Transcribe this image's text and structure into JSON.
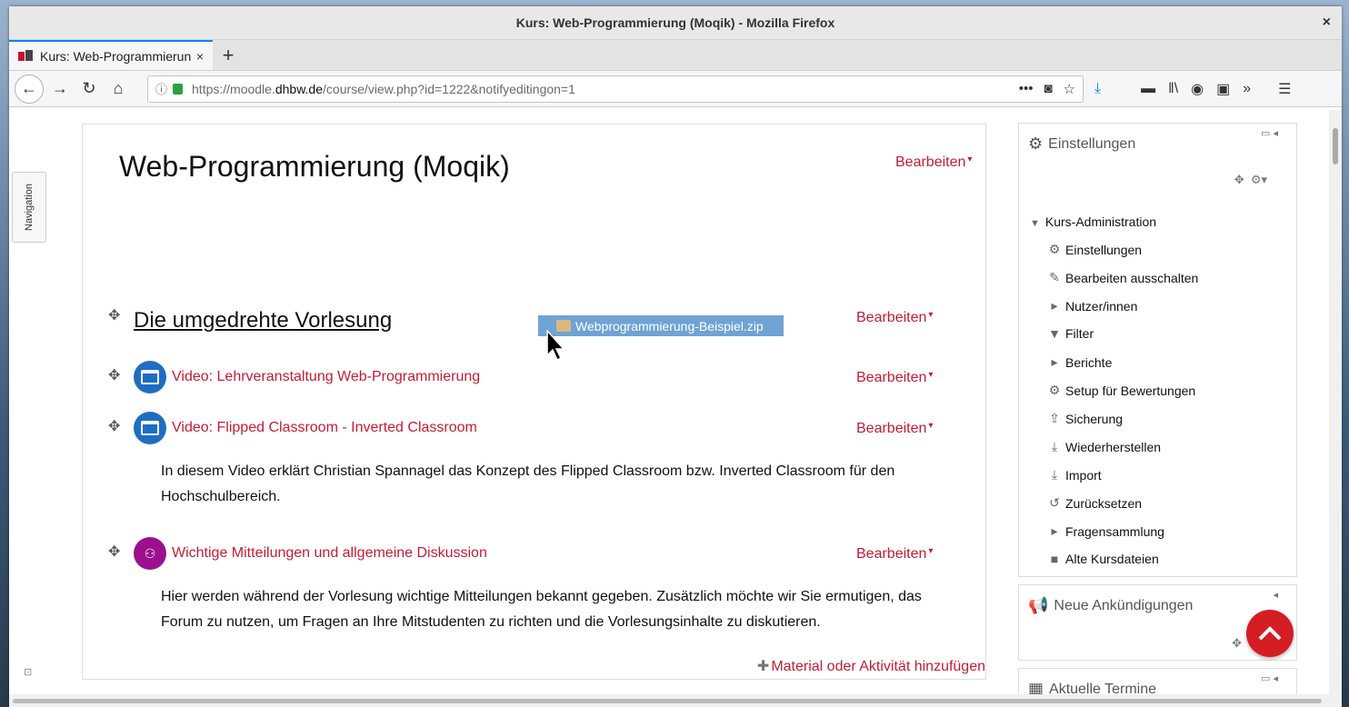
{
  "window": {
    "title": "Kurs: Web-Programmierung (Moqik) - Mozilla Firefox",
    "close": "×"
  },
  "tab": {
    "title": "Kurs: Web-Programmierung (Moqik)",
    "close": "×",
    "new_tab": "+"
  },
  "toolbar": {
    "url_prefix": "https://moodle.",
    "url_domain": "dhbw.de",
    "url_path": "/course/view.php?id=1222&notifyeditingon=1",
    "back": "←",
    "forward": "→",
    "reload": "↻",
    "home": "⌂"
  },
  "nav_drawer": {
    "label": "Navigation"
  },
  "course": {
    "title": "Web-Programmierung (Moqik)",
    "edit_label": "Bearbeiten"
  },
  "section": {
    "title": "Die umgedrehte Vorlesung",
    "edit_label": "Bearbeiten"
  },
  "drag_file": {
    "name": "Webprogrammierung-Beispiel.zip"
  },
  "activities": [
    {
      "title": "Video: Lehrveranstaltung Web-Programmierung",
      "edit_label": "Bearbeiten",
      "description": ""
    },
    {
      "title": "Video: Flipped Classroom - Inverted Classroom",
      "edit_label": "Bearbeiten",
      "description": "In diesem Video erklärt Christian Spannagel das Konzept des Flipped Classroom bzw. Inverted Classroom für den Hochschulbereich."
    },
    {
      "title": "Wichtige Mitteilungen und allgemeine Diskussion",
      "edit_label": "Bearbeiten",
      "description": "Hier werden während der Vorlesung wichtige Mitteilungen bekannt gegeben. Zusätzlich möchte wir Sie ermutigen, das Forum zu nutzen, um Fragen an Ihre Mitstudenten zu richten und die Vorlesungsinhalte zu diskutieren."
    }
  ],
  "add_material": "Material oder Aktivität hinzufügen",
  "settings_block": {
    "title": "Einstellungen",
    "root": "Kurs-Administration",
    "items": [
      {
        "label": "Einstellungen",
        "icon": "gear-icon"
      },
      {
        "label": "Bearbeiten ausschalten",
        "icon": "pencil-icon"
      },
      {
        "label": "Nutzer/innen",
        "icon": "caret-right-icon"
      },
      {
        "label": "Filter",
        "icon": "filter-icon"
      },
      {
        "label": "Berichte",
        "icon": "caret-right-icon"
      },
      {
        "label": "Setup für Bewertungen",
        "icon": "gear-icon"
      },
      {
        "label": "Sicherung",
        "icon": "upload-icon"
      },
      {
        "label": "Wiederherstellen",
        "icon": "download-icon"
      },
      {
        "label": "Import",
        "icon": "download-icon"
      },
      {
        "label": "Zurücksetzen",
        "icon": "reset-icon"
      },
      {
        "label": "Fragensammlung",
        "icon": "caret-right-icon"
      },
      {
        "label": "Alte Kursdateien",
        "icon": "folder-icon"
      }
    ]
  },
  "announcements_block": {
    "title": "Neue Ankündigungen"
  },
  "calendar_block": {
    "title": "Aktuelle Termine"
  },
  "colors": {
    "accent": "#c41c36",
    "activity_blue": "#1f6dc2",
    "forum_purple": "#9c0f8e",
    "fab_red": "#d51d24"
  }
}
